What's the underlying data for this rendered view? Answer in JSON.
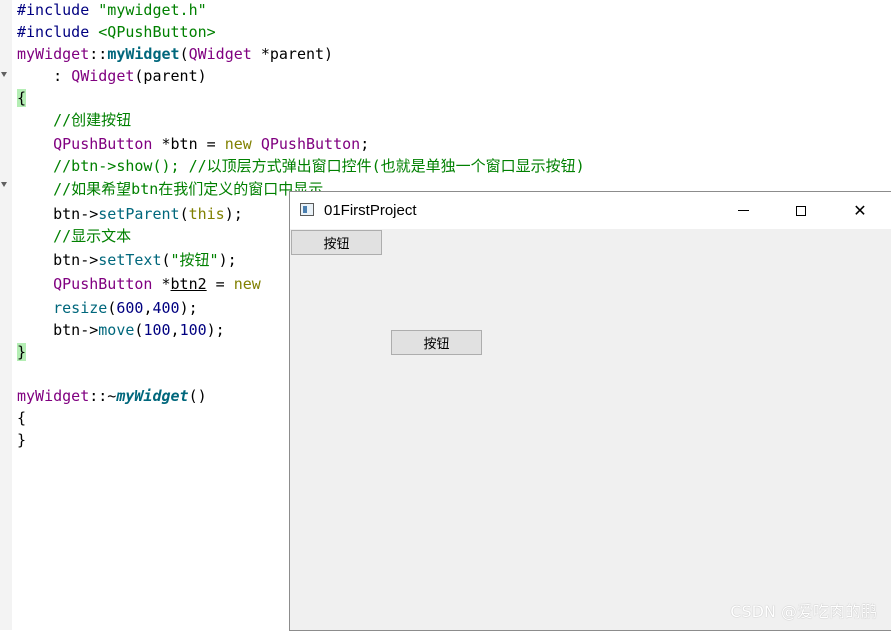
{
  "editor": {
    "lines": {
      "l1": {
        "a": "#include ",
        "b": "\"mywidget.h\""
      },
      "l2": {
        "a": "#include ",
        "b": "<QPushButton>"
      },
      "l3": {
        "a": "myWidget",
        "b": "::",
        "c": "myWidget",
        "d": "(",
        "e": "QWidget",
        "f": " *parent)"
      },
      "l4": {
        "a": "    : ",
        "b": "QWidget",
        "c": "(parent)"
      },
      "l5": {
        "a": "{"
      },
      "l6": {
        "a": "    //创建按钮"
      },
      "l7": {
        "a": "    ",
        "b": "QPushButton",
        "c": " *btn = ",
        "d": "new",
        "e": " ",
        "f": "QPushButton",
        "g": ";"
      },
      "l8": {
        "a": "    //btn->show(); //以顶层方式弹出窗口控件(也就是单独一个窗口显示按钮)"
      },
      "l9": {
        "a": "    //如果希望btn在我们定义的窗口中显示"
      },
      "l10": {
        "a": "    btn->",
        "b": "setParent",
        "c": "(",
        "d": "this",
        "e": ");"
      },
      "l11": {
        "a": "    //显示文本"
      },
      "l12": {
        "a": "    btn->",
        "b": "setText",
        "c": "(",
        "d": "\"按钮\"",
        "e": ");"
      },
      "l13": {
        "a": "    ",
        "b": "QPushButton",
        "c": " *",
        "d": "btn2",
        "e": " = ",
        "f": "new"
      },
      "l14": {
        "a": "    ",
        "b": "resize",
        "c": "(",
        "d": "600",
        "e": ",",
        "f": "400",
        "g": ");"
      },
      "l15": {
        "a": "    btn->",
        "b": "move",
        "c": "(",
        "d": "100",
        "e": ",",
        "f": "100",
        "g": ");"
      },
      "l16": {
        "a": "}"
      },
      "l17": {
        "a": "myWidget",
        "b": "::~",
        "c": "myWidget",
        "d": "()"
      },
      "l18": {
        "a": "{"
      },
      "l19": {
        "a": "}"
      }
    }
  },
  "window": {
    "title": "01FirstProject",
    "close_glyph": "✕",
    "button1_label": "按钮",
    "button2_label": "按钮"
  },
  "watermark": "CSDN @爱吃肉的鹏",
  "icons": [
    "app-window-icon",
    "minimize-icon",
    "maximize-icon",
    "close-icon",
    "fold-marker-icon"
  ]
}
